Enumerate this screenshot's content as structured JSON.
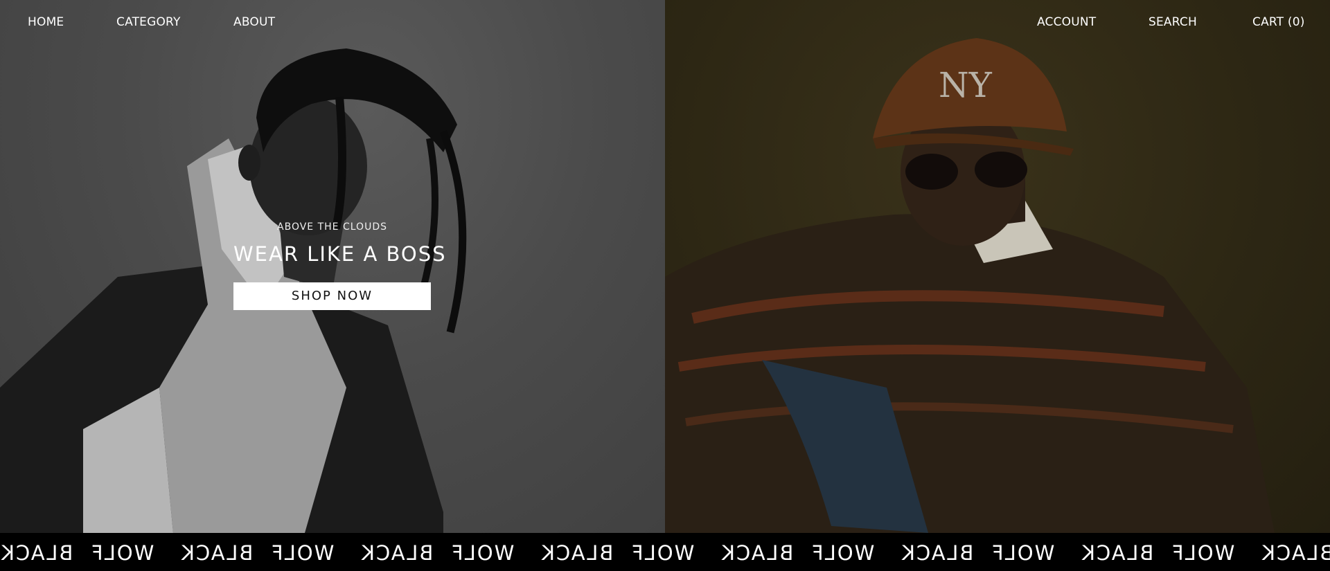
{
  "nav": {
    "left": [
      {
        "label": "HOME"
      },
      {
        "label": "CATEGORY"
      },
      {
        "label": "ABOUT"
      }
    ],
    "right": [
      {
        "label": "ACCOUNT"
      },
      {
        "label": "SEARCH"
      },
      {
        "label": "CART (0)"
      }
    ]
  },
  "hero": {
    "eyebrow": "ABOVE THE CLOUDS",
    "title": "WEAR LIKE A BOSS",
    "cta_label": "SHOP NOW"
  },
  "marquee": {
    "words": [
      "BLACK",
      "WOLF",
      "BLACK",
      "WOLF",
      "BLACK",
      "WOLF",
      "BLACK",
      "WOLF",
      "BLACK",
      "WOLF",
      "BLACK",
      "WOLF",
      "BLACK",
      "WOLF",
      "BLACK"
    ],
    "mirrored": true
  },
  "colors": {
    "left_panel": "#4a4a4a",
    "right_panel": "#2f2a17",
    "text": "#ffffff",
    "button_bg": "#ffffff",
    "marquee_bg": "#000000"
  }
}
